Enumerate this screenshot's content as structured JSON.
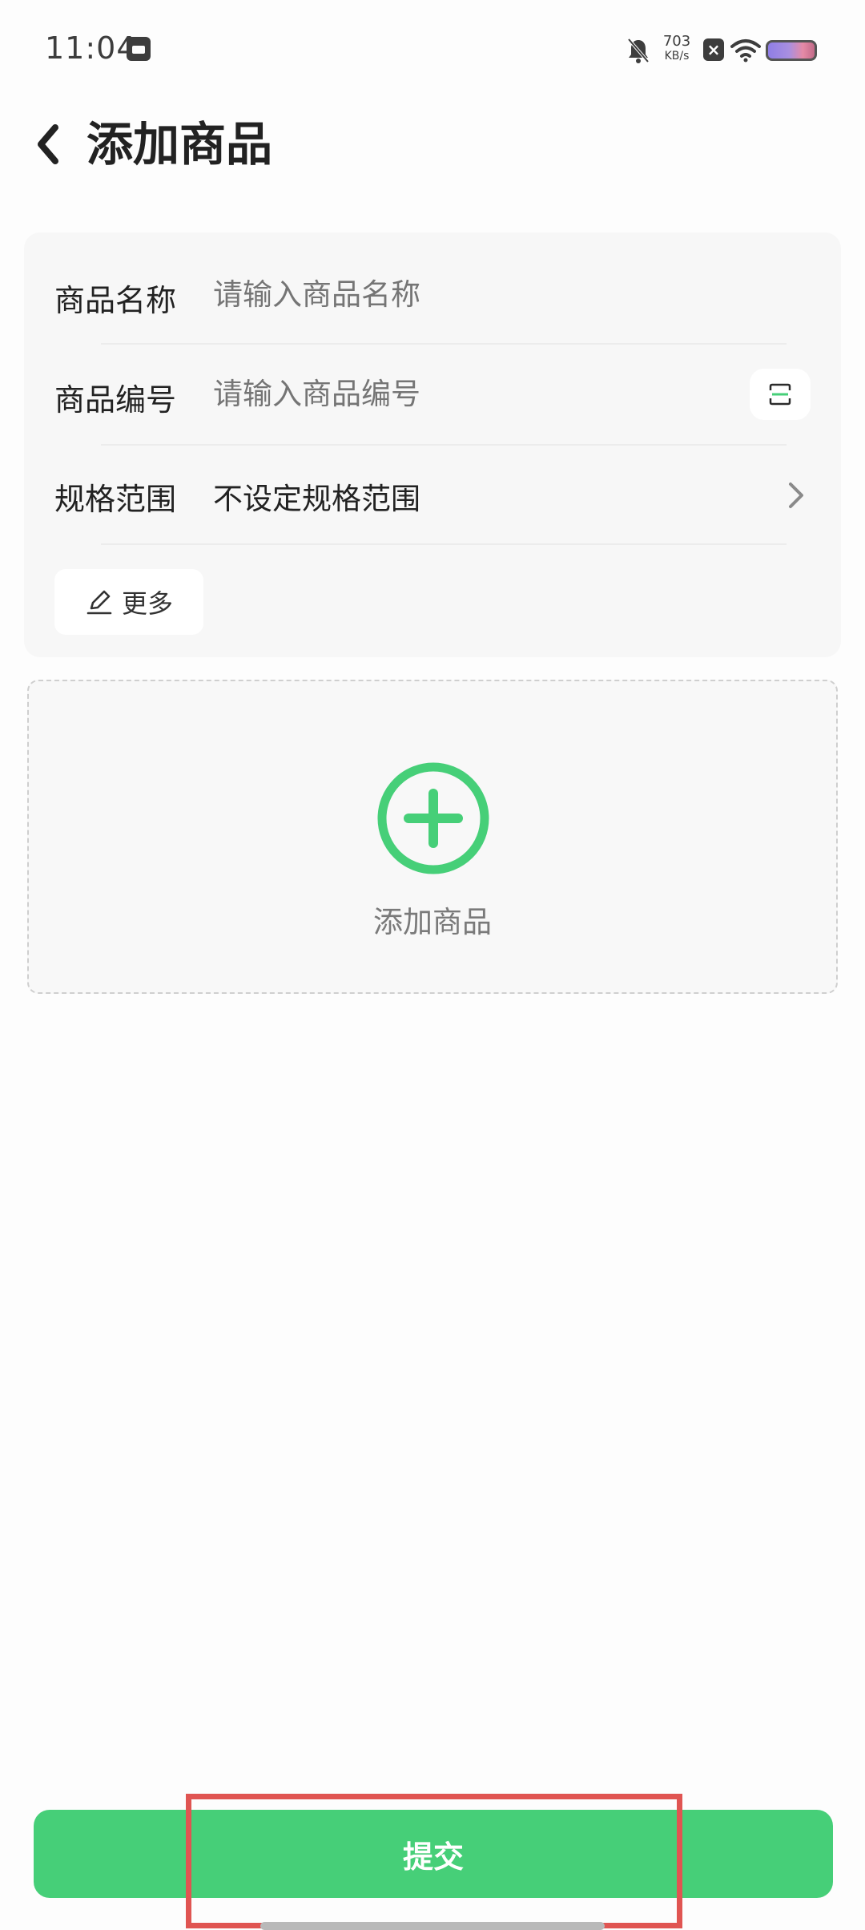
{
  "status_bar": {
    "time": "11:04",
    "net_speed_value": "703",
    "net_speed_unit": "KB/s",
    "nfc_badge": "×",
    "icons": [
      "notification-app-icon",
      "bell-off-icon",
      "nfc-icon",
      "wifi-icon",
      "battery-icon"
    ]
  },
  "header": {
    "title": "添加商品",
    "back_icon": "chevron-left-icon"
  },
  "form": {
    "name": {
      "label": "商品名称",
      "value": "",
      "placeholder": "请输入商品名称"
    },
    "code": {
      "label": "商品编号",
      "value": "",
      "placeholder": "请输入商品编号",
      "scan_icon": "scan-icon"
    },
    "spec": {
      "label": "规格范围",
      "value": "不设定规格范围",
      "chevron_icon": "chevron-right-icon"
    },
    "more": {
      "label": "更多",
      "icon": "pencil-icon"
    }
  },
  "add_product": {
    "label": "添加商品",
    "icon": "plus-circle-icon",
    "color": "#46cf78"
  },
  "submit": {
    "label": "提交",
    "color": "#46cf78"
  },
  "highlight_color": "#e05552"
}
